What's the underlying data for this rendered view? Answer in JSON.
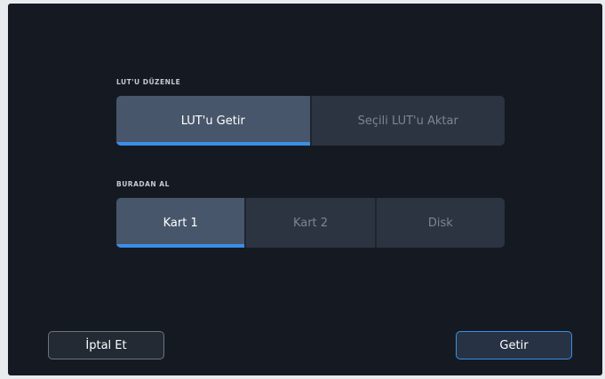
{
  "edit_lut": {
    "title": "LUT'U DÜZENLE",
    "options": [
      {
        "label": "LUT'u Getir",
        "selected": true
      },
      {
        "label": "Seçili LUT'u Aktar",
        "selected": false
      }
    ]
  },
  "source": {
    "title": "BURADAN AL",
    "options": [
      {
        "label": "Kart 1",
        "selected": true
      },
      {
        "label": "Kart 2",
        "selected": false
      },
      {
        "label": "Disk",
        "selected": false
      }
    ]
  },
  "footer": {
    "cancel_label": "İptal Et",
    "confirm_label": "Getir"
  },
  "colors": {
    "accent": "#3a8fe6",
    "background": "#151a22",
    "selected": "#48566b",
    "unselected": "#2b3440"
  }
}
